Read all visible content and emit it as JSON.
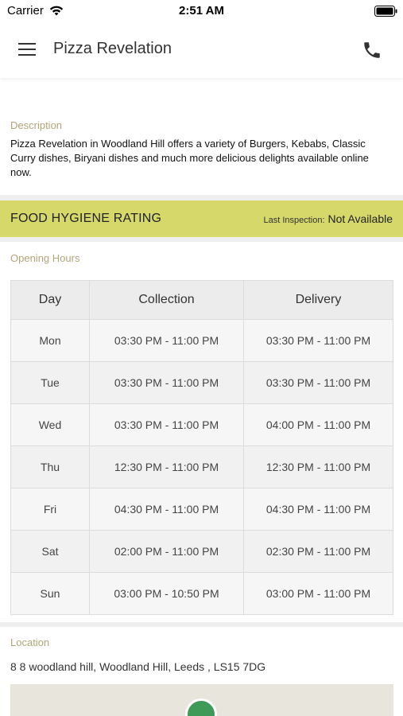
{
  "status": {
    "carrier": "Carrier",
    "time": "2:51 AM"
  },
  "header": {
    "title": "Pizza Revelation"
  },
  "description": {
    "label": "Description",
    "text": "Pizza Revelation in Woodland Hill offers a variety of Burgers, Kebabs, Classic Curry dishes, Biryani dishes and much more delicious delights available online now."
  },
  "hygiene": {
    "title": "FOOD HYGIENE RATING",
    "inspection_label": "Last Inspection:",
    "inspection_value": "Not Available"
  },
  "hours": {
    "label": "Opening Hours",
    "headers": [
      "Day",
      "Collection",
      "Delivery"
    ],
    "rows": [
      {
        "day": "Mon",
        "collection": "03:30 PM - 11:00 PM",
        "delivery": "03:30 PM - 11:00 PM"
      },
      {
        "day": "Tue",
        "collection": "03:30 PM - 11:00 PM",
        "delivery": "03:30 PM - 11:00 PM"
      },
      {
        "day": "Wed",
        "collection": "03:30 PM - 11:00 PM",
        "delivery": "04:00 PM - 11:00 PM"
      },
      {
        "day": "Thu",
        "collection": "12:30 PM - 11:00 PM",
        "delivery": "12:30 PM - 11:00 PM"
      },
      {
        "day": "Fri",
        "collection": "04:30 PM - 11:00 PM",
        "delivery": "04:30 PM - 11:00 PM"
      },
      {
        "day": "Sat",
        "collection": "02:00 PM - 11:00 PM",
        "delivery": "02:30 PM - 11:00 PM"
      },
      {
        "day": "Sun",
        "collection": "03:00 PM - 10:50 PM",
        "delivery": "03:00 PM - 11:00 PM"
      }
    ]
  },
  "location": {
    "label": "Location",
    "address": "8 8 woodland hill, Woodland Hill, Leeds , LS15 7DG"
  },
  "colors": {
    "hygiene_bar": "#d6d86a",
    "section_label": "#b0a57a",
    "map_pin": "#3f9a58"
  },
  "icons": {
    "menu": "hamburger-menu-icon",
    "phone": "phone-icon",
    "wifi": "wifi-icon",
    "battery": "battery-icon",
    "map_pin": "map-pin-icon"
  }
}
